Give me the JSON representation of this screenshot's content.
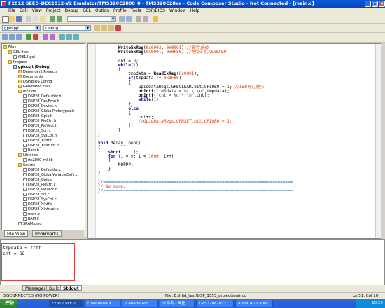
{
  "window": {
    "title": "F2812 SEED-DEC2812-V2 Emulator/TMS320C2800_0 - TMS320C28xx - Code Composer Studio - Not Connected - [main.c]",
    "controls": [
      "_",
      "□",
      "×"
    ]
  },
  "menu": [
    "File",
    "Edit",
    "View",
    "Project",
    "Debug",
    "GEL",
    "Option",
    "Profile",
    "Tools",
    "DSP/BIOS",
    "Window",
    "Help"
  ],
  "toolbar": {
    "project_select": "gpio.pjt",
    "config_select": "Debug"
  },
  "project_tree": [
    {
      "label": "Files",
      "indent": 0,
      "icon": "folder"
    },
    {
      "label": "GEL files",
      "indent": 1,
      "icon": "folder"
    },
    {
      "label": "f2812.gel",
      "indent": 2,
      "icon": "file"
    },
    {
      "label": "Projects",
      "indent": 1,
      "icon": "folder"
    },
    {
      "label": "gpio.pjt (Debug)",
      "indent": 2,
      "icon": "project"
    },
    {
      "label": "Dependent Projects",
      "indent": 3,
      "icon": "folder"
    },
    {
      "label": "Documents",
      "indent": 3,
      "icon": "folder"
    },
    {
      "label": "DSP/BIOS Config",
      "indent": 3,
      "icon": "folder"
    },
    {
      "label": "Generated Files",
      "indent": 3,
      "icon": "folder"
    },
    {
      "label": "Include",
      "indent": 3,
      "icon": "folder"
    },
    {
      "label": "DSP28_DefaultIsr.h",
      "indent": 4,
      "icon": "file"
    },
    {
      "label": "DSP28_DevEmu.h",
      "indent": 4,
      "icon": "file"
    },
    {
      "label": "DSP28_Device.h",
      "indent": 4,
      "icon": "file"
    },
    {
      "label": "DSP28_GlobalPrototypes.h",
      "indent": 4,
      "icon": "file"
    },
    {
      "label": "DSP28_Gpio.h",
      "indent": 4,
      "icon": "file"
    },
    {
      "label": "DSP28_PieCtrl.h",
      "indent": 4,
      "icon": "file"
    },
    {
      "label": "DSP28_PieVect.h",
      "indent": 4,
      "icon": "file"
    },
    {
      "label": "DSP28_Sci.h",
      "indent": 4,
      "icon": "file"
    },
    {
      "label": "DSP28_SysCtrl.h",
      "indent": 4,
      "icon": "file"
    },
    {
      "label": "DSP28_Xintf.h",
      "indent": 4,
      "icon": "file"
    },
    {
      "label": "DSP28_XIntrupt.h",
      "indent": 4,
      "icon": "file"
    },
    {
      "label": "Ram.h",
      "indent": 4,
      "icon": "file"
    },
    {
      "label": "Libraries",
      "indent": 3,
      "icon": "folder"
    },
    {
      "label": "rts2800_ml.lib",
      "indent": 4,
      "icon": "file"
    },
    {
      "label": "Source",
      "indent": 3,
      "icon": "folder"
    },
    {
      "label": "DSP28_DefaultIsr.c",
      "indent": 4,
      "icon": "file"
    },
    {
      "label": "DSP28_GlobalVariableDefs.c",
      "indent": 4,
      "icon": "file"
    },
    {
      "label": "DSP28_Gpio.c",
      "indent": 4,
      "icon": "file"
    },
    {
      "label": "DSP28_PieCtrl.c",
      "indent": 4,
      "icon": "file"
    },
    {
      "label": "DSP28_PieVect.c",
      "indent": 4,
      "icon": "file"
    },
    {
      "label": "DSP28_Sci.c",
      "indent": 4,
      "icon": "file"
    },
    {
      "label": "DSP28_SysCtrl.c",
      "indent": 4,
      "icon": "file"
    },
    {
      "label": "DSP28_Xintf.c",
      "indent": 4,
      "icon": "file"
    },
    {
      "label": "DSP28_XIntrupt.c",
      "indent": 4,
      "icon": "file"
    },
    {
      "label": "main.c",
      "indent": 4,
      "icon": "file"
    },
    {
      "label": "RAM.C",
      "indent": 4,
      "icon": "file"
    },
    {
      "label": "SRAM.cmd",
      "indent": 3,
      "icon": "file"
    }
  ],
  "left_tabs": [
    "File View",
    "Bookmarks"
  ],
  "code_lines": [
    [
      {
        "t": "        "
      },
      {
        "t": "WriteExReg",
        "c": "fn"
      },
      {
        "t": "("
      },
      {
        "t": "0x0003",
        "c": "num"
      },
      {
        "t": ", "
      },
      {
        "t": "0x0001",
        "c": "num"
      },
      {
        "t": ");"
      },
      {
        "t": "//软件复位",
        "c": "cm"
      }
    ],
    [
      {
        "t": "        "
      },
      {
        "t": "WriteExReg",
        "c": "fn"
      },
      {
        "t": "("
      },
      {
        "t": "0x0001",
        "c": "num"
      },
      {
        "t": ", "
      },
      {
        "t": "0x0F80",
        "c": "num"
      },
      {
        "t": ");"
      },
      {
        "t": "//地址1写入0x0F80",
        "c": "cm"
      }
    ],
    [
      {
        "t": ""
      }
    ],
    [
      {
        "t": "        cnt = "
      },
      {
        "t": "0",
        "c": "num"
      },
      {
        "t": ";"
      }
    ],
    [
      {
        "t": "        "
      },
      {
        "t": "while",
        "c": "kw"
      },
      {
        "t": "("
      },
      {
        "t": "1",
        "c": "num"
      },
      {
        "t": ")"
      }
    ],
    [
      {
        "t": "        {"
      }
    ],
    [
      {
        "t": "            tmpdata = "
      },
      {
        "t": "ReadExReg",
        "c": "fn"
      },
      {
        "t": "("
      },
      {
        "t": "0x0001",
        "c": "num"
      },
      {
        "t": ");"
      }
    ],
    [
      {
        "t": "            "
      },
      {
        "t": "if",
        "c": "kw"
      },
      {
        "t": "(tmpdata != "
      },
      {
        "t": "0x0F80",
        "c": "num"
      },
      {
        "t": ")"
      }
    ],
    [
      {
        "t": "            {"
      }
    ],
    [
      {
        "t": "                GpioDataRegs.GPBCLEAR.bit.GPIOB0 = "
      },
      {
        "t": "1",
        "c": "num"
      },
      {
        "t": "; "
      },
      {
        "t": "//LED亮灯提示",
        "c": "cm"
      }
    ],
    [
      {
        "t": "                "
      },
      {
        "t": "printf",
        "c": "fn"
      },
      {
        "t": "("
      },
      {
        "t": "\"tmpdata = %x \\r\\n\"",
        "c": "str"
      },
      {
        "t": ",tmpdata);"
      }
    ],
    [
      {
        "t": "                "
      },
      {
        "t": "printf",
        "c": "fn"
      },
      {
        "t": "("
      },
      {
        "t": "\"cnt = %d \\r\\n\"",
        "c": "str"
      },
      {
        "t": ",cnt);"
      }
    ],
    [
      {
        "t": "                "
      },
      {
        "t": "while",
        "c": "kw"
      },
      {
        "t": "("
      },
      {
        "t": "1",
        "c": "num"
      },
      {
        "t": ");"
      }
    ],
    [
      {
        "t": "            }"
      }
    ],
    [
      {
        "t": "            "
      },
      {
        "t": "else",
        "c": "kw"
      }
    ],
    [
      {
        "t": "            {"
      }
    ],
    [
      {
        "t": "                cnt++;"
      }
    ],
    [
      {
        "t": "                "
      },
      {
        "t": "//GpioDataRegs.GPBSET.bit.GPIOB0 = 1;",
        "c": "cm"
      }
    ],
    [
      {
        "t": "            |}"
      }
    ],
    [
      {
        "t": "        }"
      }
    ],
    [
      {
        "t": "}"
      }
    ],
    [
      {
        "t": ""
      }
    ],
    [
      {
        "t": "void",
        "c": "kw"
      },
      {
        "t": " delay_loop()"
      }
    ],
    [
      {
        "t": "{"
      }
    ],
    [
      {
        "t": "    "
      },
      {
        "t": "short",
        "c": "kw"
      },
      {
        "t": "     i;"
      }
    ],
    [
      {
        "t": "    "
      },
      {
        "t": "for",
        "c": "kw"
      },
      {
        "t": " (i = "
      },
      {
        "t": "0",
        "c": "num"
      },
      {
        "t": "; i < "
      },
      {
        "t": "1000",
        "c": "num"
      },
      {
        "t": "; i++)"
      }
    ],
    [
      {
        "t": "    {"
      }
    ],
    [
      {
        "t": "        NOPPP;"
      }
    ],
    [
      {
        "t": "    }"
      }
    ],
    [
      {
        "t": "}"
      }
    ],
    [
      {
        "t": ""
      }
    ],
    [
      {
        "t": "//===========================================================================",
        "c": "sep"
      }
    ],
    [
      {
        "t": "// No more.",
        "c": "cm"
      }
    ],
    [
      {
        "t": "//===========================================================================",
        "c": "sep"
      }
    ]
  ],
  "output_text": "tmpdata = ffff\ncnt = 66",
  "output_tabs": [
    "Messages",
    "Build",
    "Stdout"
  ],
  "status": {
    "connection": "DISCONNECTED (NO POWER)",
    "file": "File: E:\\hhd_test\\DSP_1553_project\\main.c",
    "position": "Ln 51, Col 10"
  },
  "taskbar": {
    "start": "开始",
    "tasks": [
      "F2812 SEED",
      "E:Windows X...",
      "2 Adobe Acr...",
      "未命名 - 画图",
      "TMS320F2812",
      "AutoCAD Captu..."
    ],
    "tray": "10:25"
  }
}
